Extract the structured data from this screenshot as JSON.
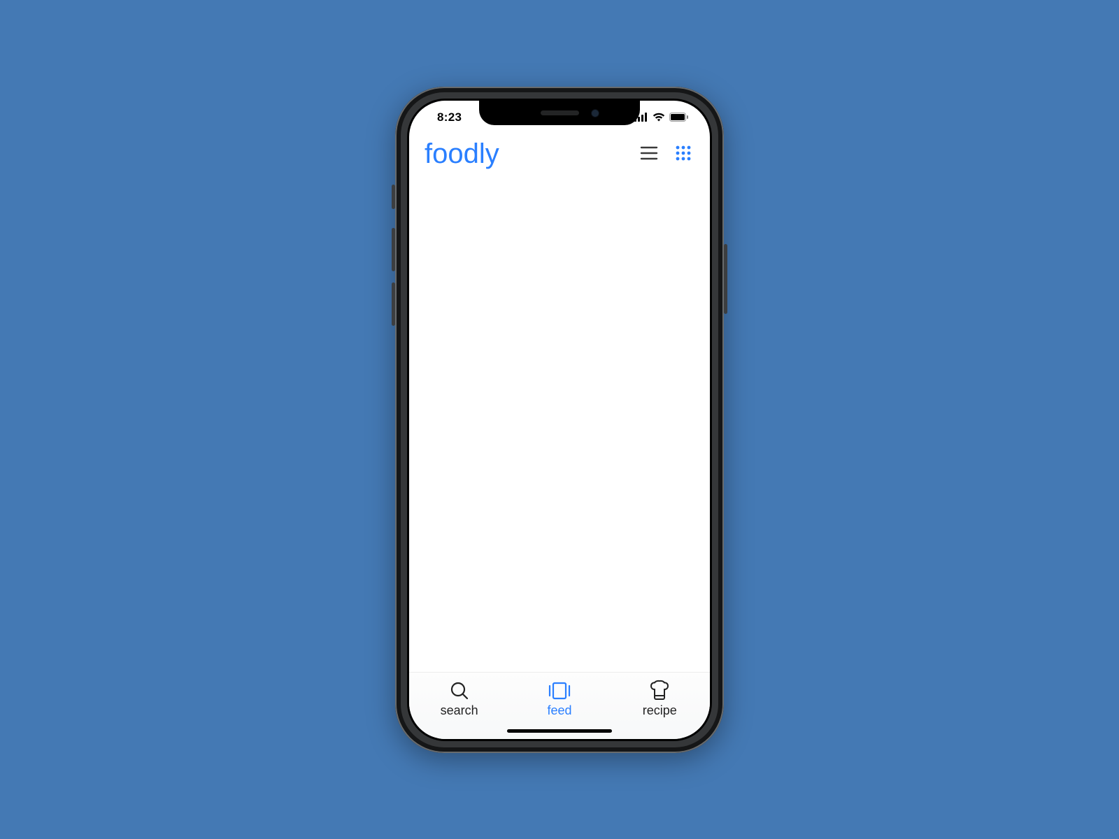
{
  "status": {
    "time": "8:23"
  },
  "header": {
    "title": "foodly"
  },
  "tabs": [
    {
      "label": "search",
      "icon": "search-icon",
      "active": false
    },
    {
      "label": "feed",
      "icon": "feed-icon",
      "active": true
    },
    {
      "label": "recipe",
      "icon": "recipe-icon",
      "active": false
    }
  ],
  "colors": {
    "accent": "#2a7fff",
    "background": "#4479b4"
  }
}
